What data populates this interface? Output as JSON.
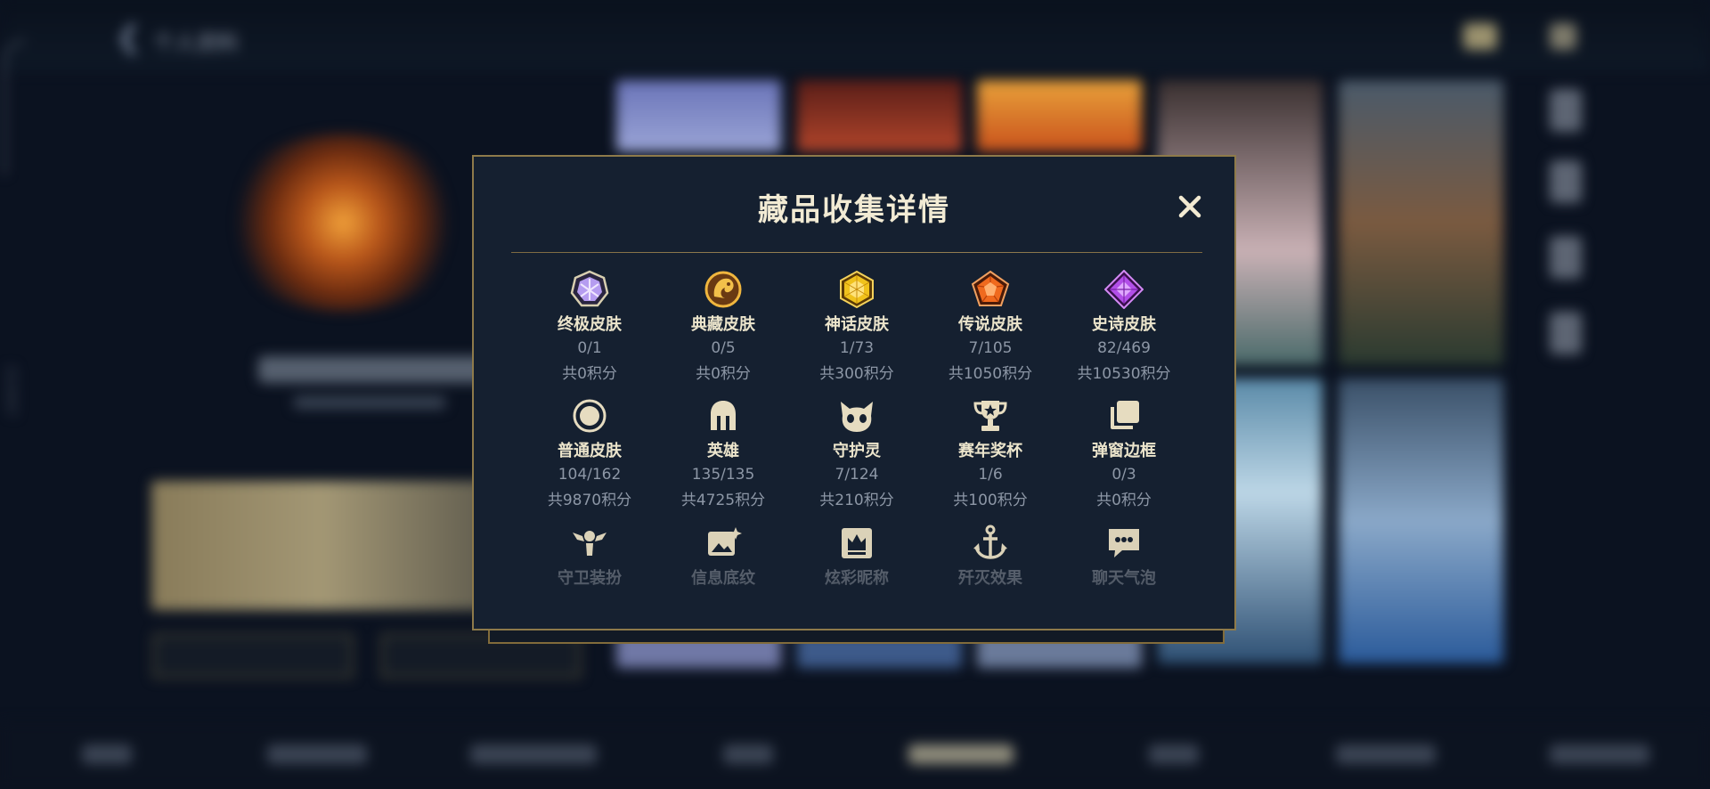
{
  "background": {
    "top_bar_title": "个人资料",
    "side_vertical_text": "2519597"
  },
  "modal": {
    "title": "藏品收集详情",
    "close_icon": "close-icon",
    "items": [
      {
        "name": "终极皮肤",
        "count": "0/1",
        "points": "共0积分",
        "icon": "ultimate-gem-icon",
        "color": "#b59cf0"
      },
      {
        "name": "典藏皮肤",
        "count": "0/5",
        "points": "共0积分",
        "icon": "dragon-emblem-icon",
        "color": "#d9a23a"
      },
      {
        "name": "神话皮肤",
        "count": "1/73",
        "points": "共300积分",
        "icon": "mythic-gem-icon",
        "color": "#f0c21c"
      },
      {
        "name": "传说皮肤",
        "count": "7/105",
        "points": "共1050积分",
        "icon": "legendary-gem-icon",
        "color": "#f06a1e"
      },
      {
        "name": "史诗皮肤",
        "count": "82/469",
        "points": "共10530积分",
        "icon": "epic-gem-icon",
        "color": "#b24ee8"
      },
      {
        "name": "普通皮肤",
        "count": "104/162",
        "points": "共9870积分",
        "icon": "circle-icon",
        "color": "#e6dcc0"
      },
      {
        "name": "英雄",
        "count": "135/135",
        "points": "共4725积分",
        "icon": "helmet-icon",
        "color": "#e6dcc0"
      },
      {
        "name": "守护灵",
        "count": "7/124",
        "points": "共210积分",
        "icon": "guardian-pet-icon",
        "color": "#e6dcc0"
      },
      {
        "name": "赛年奖杯",
        "count": "1/6",
        "points": "共100积分",
        "icon": "trophy-icon",
        "color": "#e6dcc0"
      },
      {
        "name": "弹窗边框",
        "count": "0/3",
        "points": "共0积分",
        "icon": "stacked-frames-icon",
        "color": "#e6dcc0"
      },
      {
        "name": "守卫装扮",
        "icon": "ward-icon",
        "color": "#e6dcc0"
      },
      {
        "name": "信息底纹",
        "icon": "image-sparkle-icon",
        "color": "#e6dcc0"
      },
      {
        "name": "炫彩昵称",
        "icon": "crown-card-icon",
        "color": "#e6dcc0"
      },
      {
        "name": "歼灭效果",
        "icon": "anchor-icon",
        "color": "#e6dcc0"
      },
      {
        "name": "聊天气泡",
        "icon": "chat-bubble-icon",
        "color": "#e6dcc0"
      }
    ]
  }
}
